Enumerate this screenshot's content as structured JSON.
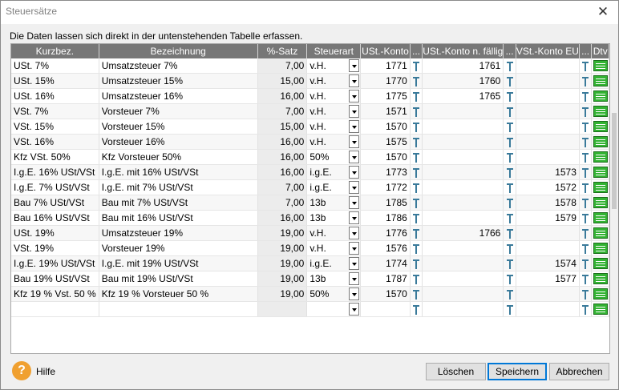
{
  "window": {
    "title": "Steuersätze",
    "close_label": "✕"
  },
  "instruction": "Die Daten lassen sich direkt in der untenstehenden Tabelle erfassen.",
  "columns": [
    "Kurzbez.",
    "Bezeichnung",
    "%-Satz",
    "Steuerart",
    "USt.-Konto",
    "...",
    "USt.-Konto n. fällig",
    "...",
    "VSt.-Konto EU",
    "...",
    "Dtv"
  ],
  "rows": [
    {
      "kurz": "USt. 7%",
      "bez": "Umsatzsteuer 7%",
      "satz": "7,00",
      "art": "v.H.",
      "ust": "1771",
      "ustnf": "1761",
      "vsteu": ""
    },
    {
      "kurz": "USt. 15%",
      "bez": "Umsatzsteuer 15%",
      "satz": "15,00",
      "art": "v.H.",
      "ust": "1770",
      "ustnf": "1760",
      "vsteu": ""
    },
    {
      "kurz": "USt. 16%",
      "bez": "Umsatzsteuer 16%",
      "satz": "16,00",
      "art": "v.H.",
      "ust": "1775",
      "ustnf": "1765",
      "vsteu": ""
    },
    {
      "kurz": "VSt. 7%",
      "bez": "Vorsteuer 7%",
      "satz": "7,00",
      "art": "v.H.",
      "ust": "1571",
      "ustnf": "",
      "vsteu": ""
    },
    {
      "kurz": "VSt. 15%",
      "bez": "Vorsteuer 15%",
      "satz": "15,00",
      "art": "v.H.",
      "ust": "1570",
      "ustnf": "",
      "vsteu": ""
    },
    {
      "kurz": "VSt. 16%",
      "bez": "Vorsteuer 16%",
      "satz": "16,00",
      "art": "v.H.",
      "ust": "1575",
      "ustnf": "",
      "vsteu": ""
    },
    {
      "kurz": "Kfz VSt. 50%",
      "bez": "Kfz Vorsteuer 50%",
      "satz": "16,00",
      "art": "50%",
      "ust": "1570",
      "ustnf": "",
      "vsteu": ""
    },
    {
      "kurz": "I.g.E. 16% USt/VSt",
      "bez": "I.g.E. mit 16% USt/VSt",
      "satz": "16,00",
      "art": "i.g.E.",
      "ust": "1773",
      "ustnf": "",
      "vsteu": "1573"
    },
    {
      "kurz": "I.g.E. 7% USt/VSt",
      "bez": "I.g.E. mit 7% USt/VSt",
      "satz": "7,00",
      "art": "i.g.E.",
      "ust": "1772",
      "ustnf": "",
      "vsteu": "1572"
    },
    {
      "kurz": "Bau 7% USt/VSt",
      "bez": "Bau mit 7% USt/VSt",
      "satz": "7,00",
      "art": "13b",
      "ust": "1785",
      "ustnf": "",
      "vsteu": "1578"
    },
    {
      "kurz": "Bau 16% USt/VSt",
      "bez": "Bau mit 16% USt/VSt",
      "satz": "16,00",
      "art": "13b",
      "ust": "1786",
      "ustnf": "",
      "vsteu": "1579"
    },
    {
      "kurz": "USt. 19%",
      "bez": "Umsatzsteuer 19%",
      "satz": "19,00",
      "art": "v.H.",
      "ust": "1776",
      "ustnf": "1766",
      "vsteu": ""
    },
    {
      "kurz": "VSt. 19%",
      "bez": "Vorsteuer 19%",
      "satz": "19,00",
      "art": "v.H.",
      "ust": "1576",
      "ustnf": "",
      "vsteu": ""
    },
    {
      "kurz": "I.g.E. 19% USt/VSt",
      "bez": "I.g.E. mit 19% USt/VSt",
      "satz": "19,00",
      "art": "i.g.E.",
      "ust": "1774",
      "ustnf": "",
      "vsteu": "1574"
    },
    {
      "kurz": "Bau 19% USt/VSt",
      "bez": "Bau mit 19% USt/VSt",
      "satz": "19,00",
      "art": "13b",
      "ust": "1787",
      "ustnf": "",
      "vsteu": "1577"
    },
    {
      "kurz": "Kfz 19 % Vst. 50 %",
      "bez": "Kfz 19 % Vorsteuer 50 %",
      "satz": "19,00",
      "art": "50%",
      "ust": "1570",
      "ustnf": "",
      "vsteu": ""
    },
    {
      "kurz": "",
      "bez": "",
      "satz": "",
      "art": "",
      "ust": "",
      "ustnf": "",
      "vsteu": ""
    }
  ],
  "icons": {
    "link": "account-link-icon",
    "dtv": "dtv-grid-icon",
    "help": "help-icon",
    "dropdown": "dropdown-arrow-icon"
  },
  "footer": {
    "help_glyph": "?",
    "help_label": "Hilfe",
    "delete_label": "Löschen",
    "save_label": "Speichern",
    "cancel_label": "Abbrechen"
  },
  "colors": {
    "header_bg": "#777777",
    "dtv_green": "#32b232",
    "help_orange": "#f0a030",
    "focus_blue": "#0078d7"
  }
}
